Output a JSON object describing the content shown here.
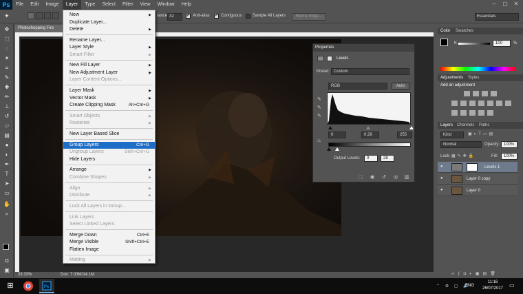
{
  "app": {
    "logo": "Ps",
    "menus": [
      "File",
      "Edit",
      "Image",
      "Layer",
      "Type",
      "Select",
      "Filter",
      "View",
      "Window",
      "Help"
    ],
    "active_menu": "Layer",
    "window_controls": [
      "–",
      "▢",
      "✕"
    ]
  },
  "options_bar": {
    "tolerance_label": "rance:",
    "tolerance_value": "32",
    "anti_alias_label": "Anti-alias",
    "contiguous_label": "Contiguous",
    "sample_all_label": "Sample All Layers",
    "refine_edge_label": "Refine Edge...",
    "workspace": "Essentials"
  },
  "document": {
    "tab_title": "Photoshopping Fire",
    "zoom": "33.33%",
    "doc_info": "Doc: 7.03M/14.1M"
  },
  "layer_menu": {
    "items": [
      {
        "label": "New",
        "arrow": "▶",
        "shortcut": "",
        "disabled": false
      },
      {
        "label": "Duplicate Layer...",
        "arrow": "",
        "shortcut": "",
        "disabled": false
      },
      {
        "label": "Delete",
        "arrow": "▶",
        "shortcut": "",
        "disabled": false
      },
      {
        "label": "Rename Layer...",
        "arrow": "",
        "shortcut": "",
        "disabled": false
      },
      {
        "label": "Layer Style",
        "arrow": "▶",
        "shortcut": "",
        "disabled": false
      },
      {
        "label": "Smart Filter",
        "arrow": "▶",
        "shortcut": "",
        "disabled": true
      },
      {
        "label": "New Fill Layer",
        "arrow": "▶",
        "shortcut": "",
        "disabled": false
      },
      {
        "label": "New Adjustment Layer",
        "arrow": "▶",
        "shortcut": "",
        "disabled": false
      },
      {
        "label": "Layer Content Options...",
        "arrow": "",
        "shortcut": "",
        "disabled": true
      },
      {
        "label": "Layer Mask",
        "arrow": "▶",
        "shortcut": "",
        "disabled": false
      },
      {
        "label": "Vector Mask",
        "arrow": "▶",
        "shortcut": "",
        "disabled": false
      },
      {
        "label": "Create Clipping Mask",
        "arrow": "",
        "shortcut": "Alt+Ctrl+G",
        "disabled": false
      },
      {
        "label": "Smart Objects",
        "arrow": "▶",
        "shortcut": "",
        "disabled": true
      },
      {
        "label": "Rasterize",
        "arrow": "▶",
        "shortcut": "",
        "disabled": true
      },
      {
        "label": "New Layer Based Slice",
        "arrow": "",
        "shortcut": "",
        "disabled": false
      },
      {
        "label": "Group Layers",
        "arrow": "",
        "shortcut": "Ctrl+G",
        "disabled": false,
        "highlighted": true
      },
      {
        "label": "Ungroup Layers",
        "arrow": "",
        "shortcut": "Shift+Ctrl+G",
        "disabled": true
      },
      {
        "label": "Hide Layers",
        "arrow": "",
        "shortcut": "",
        "disabled": false
      },
      {
        "label": "Arrange",
        "arrow": "▶",
        "shortcut": "",
        "disabled": false
      },
      {
        "label": "Combine Shapes",
        "arrow": "▶",
        "shortcut": "",
        "disabled": true
      },
      {
        "label": "Align",
        "arrow": "▶",
        "shortcut": "",
        "disabled": true
      },
      {
        "label": "Distribute",
        "arrow": "▶",
        "shortcut": "",
        "disabled": true
      },
      {
        "label": "Lock All Layers in Group...",
        "arrow": "",
        "shortcut": "",
        "disabled": true
      },
      {
        "label": "Link Layers",
        "arrow": "",
        "shortcut": "",
        "disabled": true
      },
      {
        "label": "Select Linked Layers",
        "arrow": "",
        "shortcut": "",
        "disabled": true
      },
      {
        "label": "Merge Down",
        "arrow": "",
        "shortcut": "Ctrl+E",
        "disabled": false
      },
      {
        "label": "Merge Visible",
        "arrow": "",
        "shortcut": "Shift+Ctrl+E",
        "disabled": false
      },
      {
        "label": "Flatten Image",
        "arrow": "",
        "shortcut": "",
        "disabled": false
      },
      {
        "label": "Matting",
        "arrow": "▶",
        "shortcut": "",
        "disabled": true
      }
    ]
  },
  "properties": {
    "tab": "Properties",
    "title": "Levels",
    "preset_label": "Preset:",
    "preset_value": "Custom",
    "channel": "RGB",
    "auto_label": "Auto",
    "input_black": "0",
    "input_gamma": "0.28",
    "input_white": "255",
    "output_label": "Output Levels:",
    "output_black": "0",
    "output_white": "28"
  },
  "color_panel": {
    "tabs": [
      "Color",
      "Swatches"
    ],
    "k_label": "K",
    "k_value": "100",
    "pct": "%"
  },
  "adjustments_panel": {
    "tabs": [
      "Adjustments",
      "Styles"
    ],
    "heading": "Add an adjustment"
  },
  "layers_panel": {
    "tabs": [
      "Layers",
      "Channels",
      "Paths"
    ],
    "kind": "Kind",
    "blend_mode": "Normal",
    "opacity_label": "Opacity:",
    "opacity_value": "100%",
    "lock_label": "Lock:",
    "fill_label": "Fill:",
    "fill_value": "100%",
    "layers": [
      {
        "name": "Levels 1",
        "selected": true
      },
      {
        "name": "Layer 0 copy",
        "selected": false
      },
      {
        "name": "Layer 0",
        "selected": false
      }
    ]
  },
  "taskbar": {
    "time": "11:16",
    "date": "26/07/2017",
    "lang": "ENG"
  }
}
